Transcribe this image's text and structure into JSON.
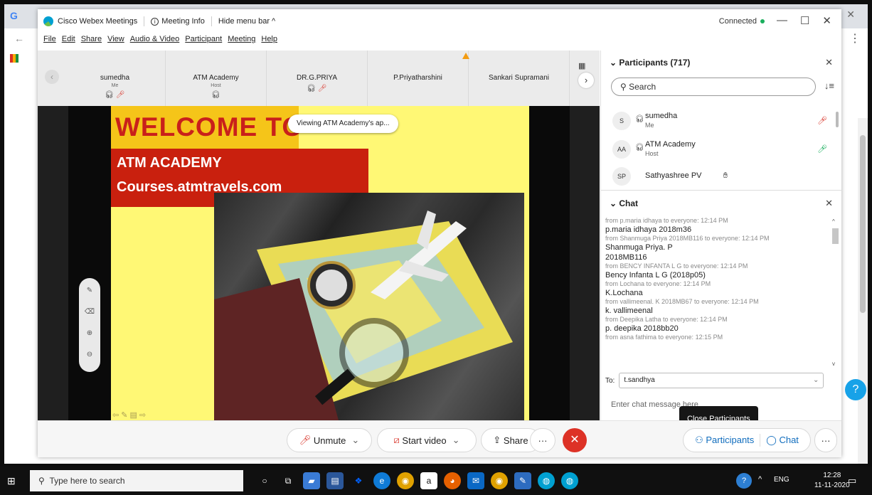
{
  "titlebar": {
    "app_name": "Cisco Webex Meetings",
    "meeting_info": "Meeting Info",
    "hide_menu": "Hide menu bar ^",
    "status": "Connected"
  },
  "menu": [
    "File",
    "Edit",
    "Share",
    "View",
    "Audio & Video",
    "Participant",
    "Meeting",
    "Help"
  ],
  "filmstrip": [
    {
      "name": "sumedha",
      "role": "Me"
    },
    {
      "name": "ATM Academy",
      "role": "Host"
    },
    {
      "name": "DR.G.PRIYA",
      "role": ""
    },
    {
      "name": "P.Priyatharshini",
      "role": ""
    },
    {
      "name": "Sankari Supramani",
      "role": ""
    }
  ],
  "slide": {
    "welcome": "WELCOME TO",
    "academy": "ATM ACADEMY",
    "courses": "Courses.atmtravels.com",
    "viewing_tip": "Viewing ATM Academy's ap..."
  },
  "participants": {
    "header": "Participants (717)",
    "search_placeholder": "Search",
    "rows": [
      {
        "initials": "S",
        "name": "sumedha",
        "role": "Me"
      },
      {
        "initials": "AA",
        "name": "ATM Academy",
        "role": "Host"
      },
      {
        "initials": "SP",
        "name": "Sathyashree PV",
        "role": ""
      }
    ]
  },
  "chat": {
    "header": "Chat",
    "messages": [
      {
        "meta": "from p.maria idhaya to everyone:   12:14 PM",
        "text": "p.maria idhaya 2018m36"
      },
      {
        "meta": "from Shanmuga Priya 2018MB116 to everyone:   12:14 PM",
        "text": "Shanmuga Priya. P\n2018MB116"
      },
      {
        "meta": "from BENCY INFANTA L G to everyone:   12:14 PM",
        "text": "Bency Infanta L G (2018p05)"
      },
      {
        "meta": "from Lochana to everyone:   12:14 PM",
        "text": "K.Lochana"
      },
      {
        "meta": "from vallimeenal. K 2018MB67 to everyone:   12:14 PM",
        "text": "k. vallimeenal"
      },
      {
        "meta": "from Deepika Latha to everyone:   12:14 PM",
        "text": "p. deepika 2018bb20"
      },
      {
        "meta": "from asna fathima to everyone:   12:15 PM",
        "text": ""
      }
    ],
    "to_label": "To:",
    "to_value": "t.sandhya",
    "input_placeholder": "Enter chat message here",
    "close_tooltip": "Close Participants"
  },
  "controls": {
    "unmute": "Unmute",
    "start_video": "Start video",
    "share": "Share",
    "more": "···",
    "participants": "Participants",
    "chat": "Chat"
  },
  "taskbar": {
    "search_placeholder": "Type here to search",
    "lang": "ENG",
    "time": "12:28",
    "date": "11-11-2020"
  },
  "colors": {
    "accent": "#0f6cbd",
    "leave": "#dd3226",
    "slide_yellow": "#fff875",
    "slide_red": "#c9200e"
  }
}
